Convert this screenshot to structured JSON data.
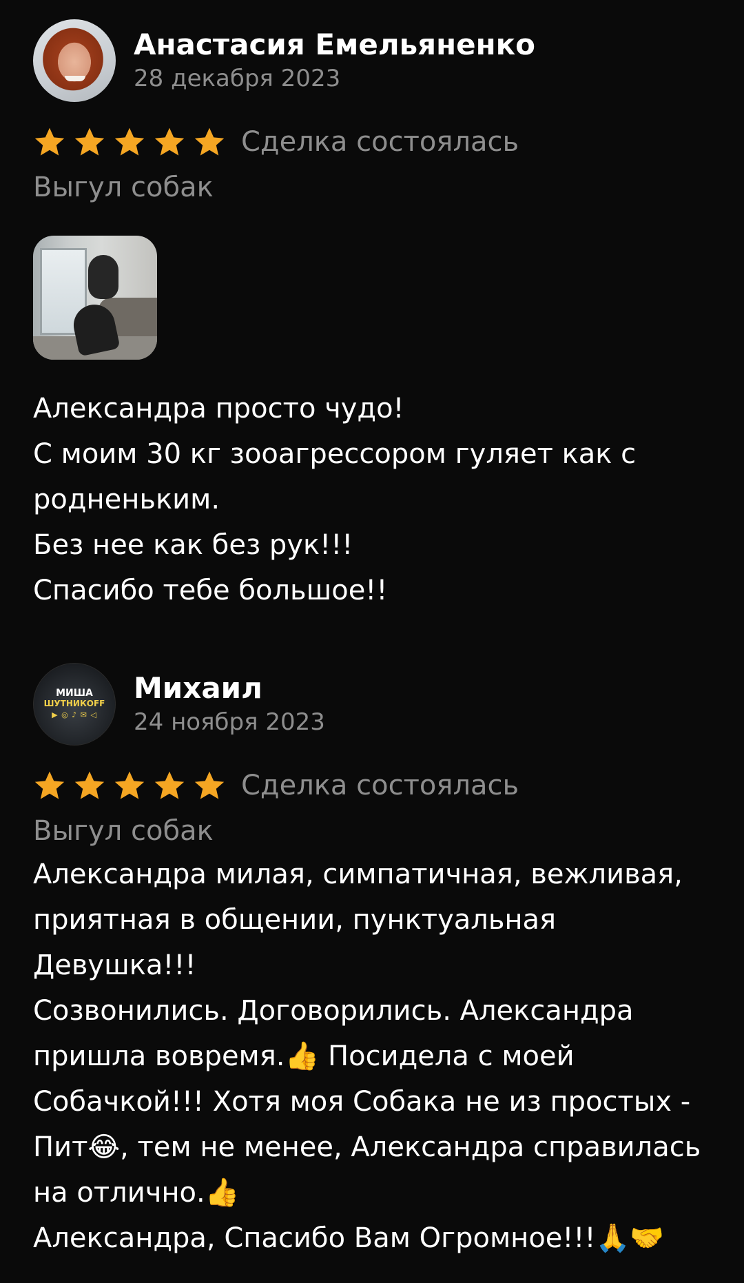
{
  "reviews": [
    {
      "author": "Анастасия Емельяненко",
      "date": "28 декабря 2023",
      "rating": 5,
      "deal_status": "Сделка состоялась",
      "category": "Выгул собак",
      "has_photo": true,
      "text": "Александра просто чудо!\nС моим 30 кг зооагрессором гуляет как с родненьким.\nБез нее как без рук!!!\nСпасибо тебе большое!!"
    },
    {
      "author": "Михаил",
      "date": "24 ноября 2023",
      "rating": 5,
      "deal_status": "Сделка состоялась",
      "category": "Выгул собак",
      "avatar_text": {
        "line1": "МИША",
        "line2": "ШУТНИКОFF"
      },
      "text": "Александра милая, симпатичная, вежливая, приятная в общении, пунктуальная Девушка!!!\nСозвонились. Договорились. Александра пришла вовремя.👍 Посидела с моей Собачкой!!! Хотя моя Собака не из простых - Пит😂, тем не менее, Александра справилась на отлично.👍\nАлександра, Спасибо Вам Огромное!!!🙏🤝"
    }
  ],
  "colors": {
    "background": "#0a0a0a",
    "star": "#f5a623",
    "muted_text": "#8e8e8e",
    "text": "#ffffff"
  }
}
